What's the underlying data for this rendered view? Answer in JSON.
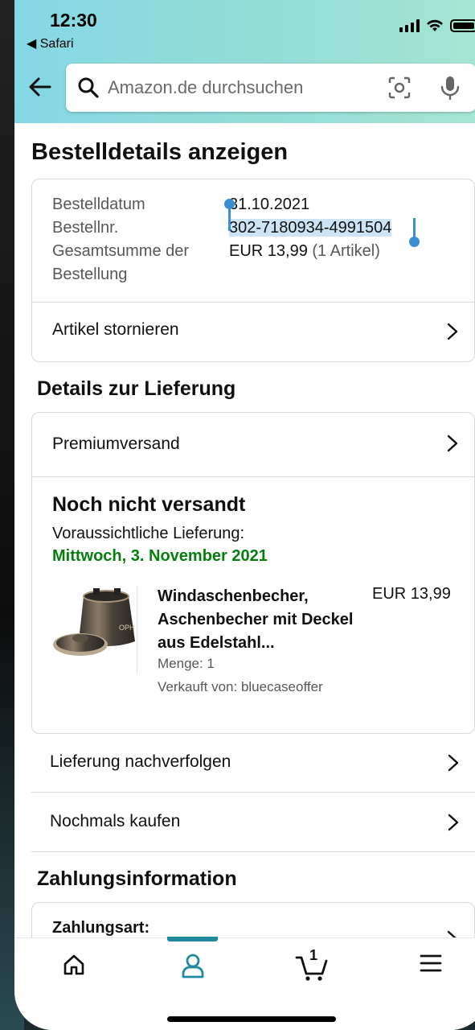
{
  "status_bar": {
    "time": "12:30",
    "back_app": "◀ Safari"
  },
  "search": {
    "placeholder": "Amazon.de durchsuchen"
  },
  "page": {
    "title": "Bestelldetails anzeigen"
  },
  "order_summary": {
    "date_label": "Bestelldatum",
    "date_value": "31.10.2021",
    "number_label": "Bestellnr.",
    "number_value": "302-7180934-4991504",
    "total_label_line1": "Gesamtsumme der",
    "total_label_line2": "Bestellung",
    "total_value": "EUR 13,99",
    "total_items": " (1 Artikel)",
    "cancel_label": "Artikel stornieren"
  },
  "delivery": {
    "section_title": "Details zur Lieferung",
    "shipping_method": "Premiumversand",
    "status": "Noch nicht versandt",
    "estimate_label": "Voraussichtliche Lieferung:",
    "estimate_date": "Mittwoch, 3. November 2021",
    "product": {
      "title": "Windaschenbecher, Aschenbecher mit Deckel aus Edelstahl...",
      "price": "EUR 13,99",
      "quantity": "Menge: 1",
      "seller": "Verkauft von: bluecaseoffer"
    }
  },
  "actions": {
    "track": "Lieferung nachverfolgen",
    "buy_again": "Nochmals kaufen"
  },
  "payment": {
    "section_title": "Zahlungsinformation",
    "method_label": "Zahlungsart:"
  },
  "nav": {
    "cart_count": "1"
  },
  "colors": {
    "header_gradient_start": "#84d8e4",
    "header_gradient_end": "#a6e6d3",
    "accent_teal": "#1f8a9e",
    "delivery_green": "#067d0e",
    "selection_blue": "#3a8fd4"
  }
}
